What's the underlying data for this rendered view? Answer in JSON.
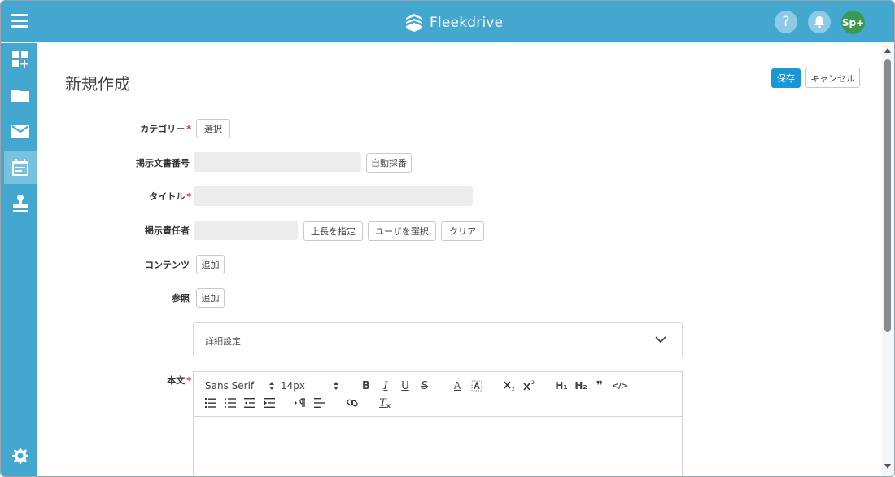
{
  "app": {
    "name": "Fleekdrive"
  },
  "header": {
    "help_label": "?",
    "avatar_label": "Sp+"
  },
  "page": {
    "title": "新規作成",
    "save_label": "保存",
    "cancel_label": "キャンセル"
  },
  "form": {
    "category": {
      "label": "カテゴリー",
      "button": "選択"
    },
    "doc_number": {
      "label": "掲示文書番号",
      "value": "",
      "button": "自動採番"
    },
    "title": {
      "label": "タイトル",
      "value": ""
    },
    "owner": {
      "label": "掲示責任者",
      "value": "",
      "btn_superior": "上長を指定",
      "btn_user": "ユーザを選択",
      "btn_clear": "クリア"
    },
    "contents": {
      "label": "コンテンツ",
      "button": "追加"
    },
    "reference": {
      "label": "参照",
      "button": "追加"
    },
    "details": {
      "label": "詳細設定"
    },
    "body": {
      "label": "本文"
    },
    "required_mark": "*"
  },
  "editor": {
    "font": "Sans Serif",
    "size": "14px",
    "bold": "B",
    "italic": "I",
    "underline": "U",
    "strike": "S",
    "color": "A",
    "h1": "H₁",
    "h2": "H₂",
    "quote": "❞",
    "code": "</>",
    "clean": "T"
  }
}
